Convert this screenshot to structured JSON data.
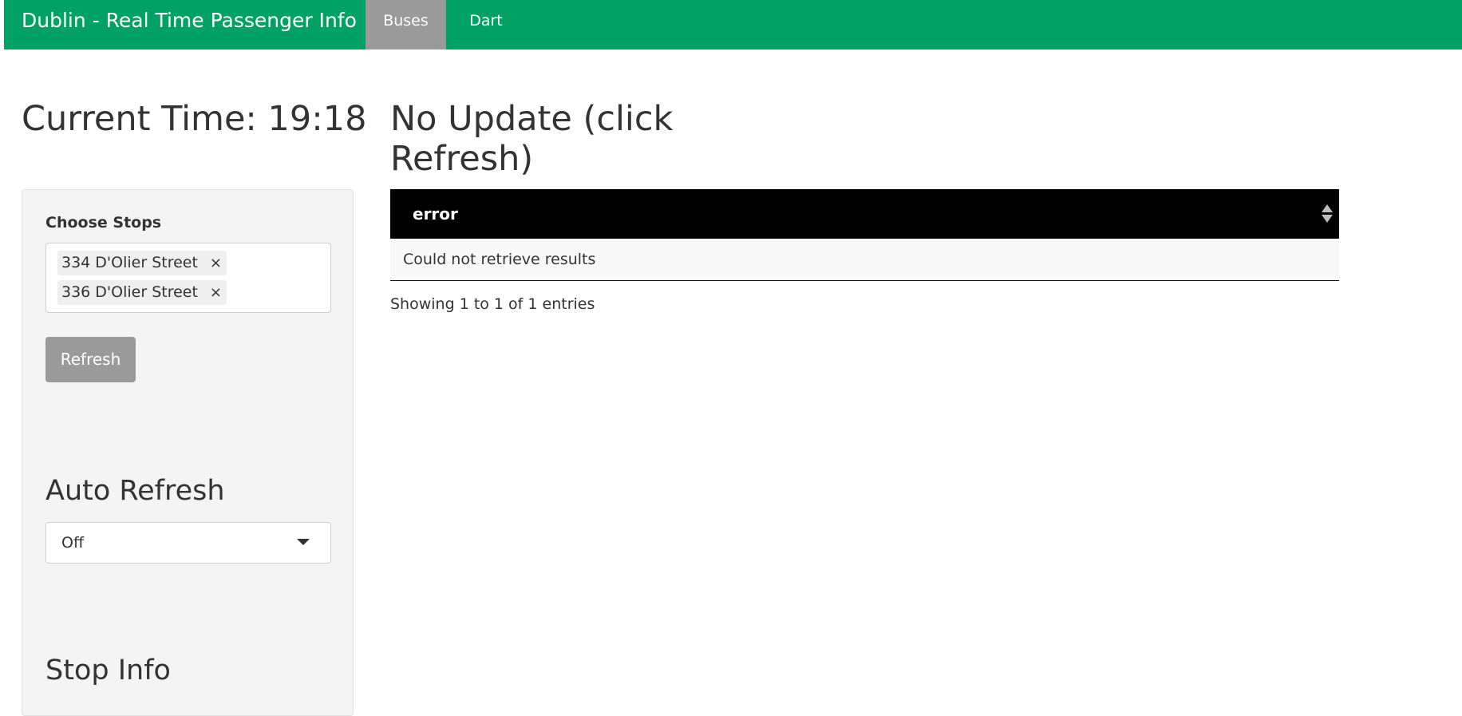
{
  "navbar": {
    "brand": "Dublin - Real Time Passenger Info",
    "tabs": [
      {
        "label": "Buses",
        "active": true
      },
      {
        "label": "Dart",
        "active": false
      }
    ],
    "color": "#00a165"
  },
  "sidebar": {
    "current_time": "Current Time: 19:18",
    "choose_stops_label": "Choose Stops",
    "selected_stops": [
      "334 D'Olier Street",
      "336 D'Olier Street"
    ],
    "remove_icon": "×",
    "refresh_label": "Refresh",
    "auto_refresh_heading": "Auto Refresh",
    "auto_refresh_value": "Off",
    "stop_info_heading": "Stop Info"
  },
  "main": {
    "title": "No Update (click Refresh)",
    "table": {
      "columns": [
        "error"
      ],
      "rows": [
        [
          "Could not retrieve results"
        ]
      ]
    },
    "info": "Showing 1 to 1 of 1 entries"
  }
}
